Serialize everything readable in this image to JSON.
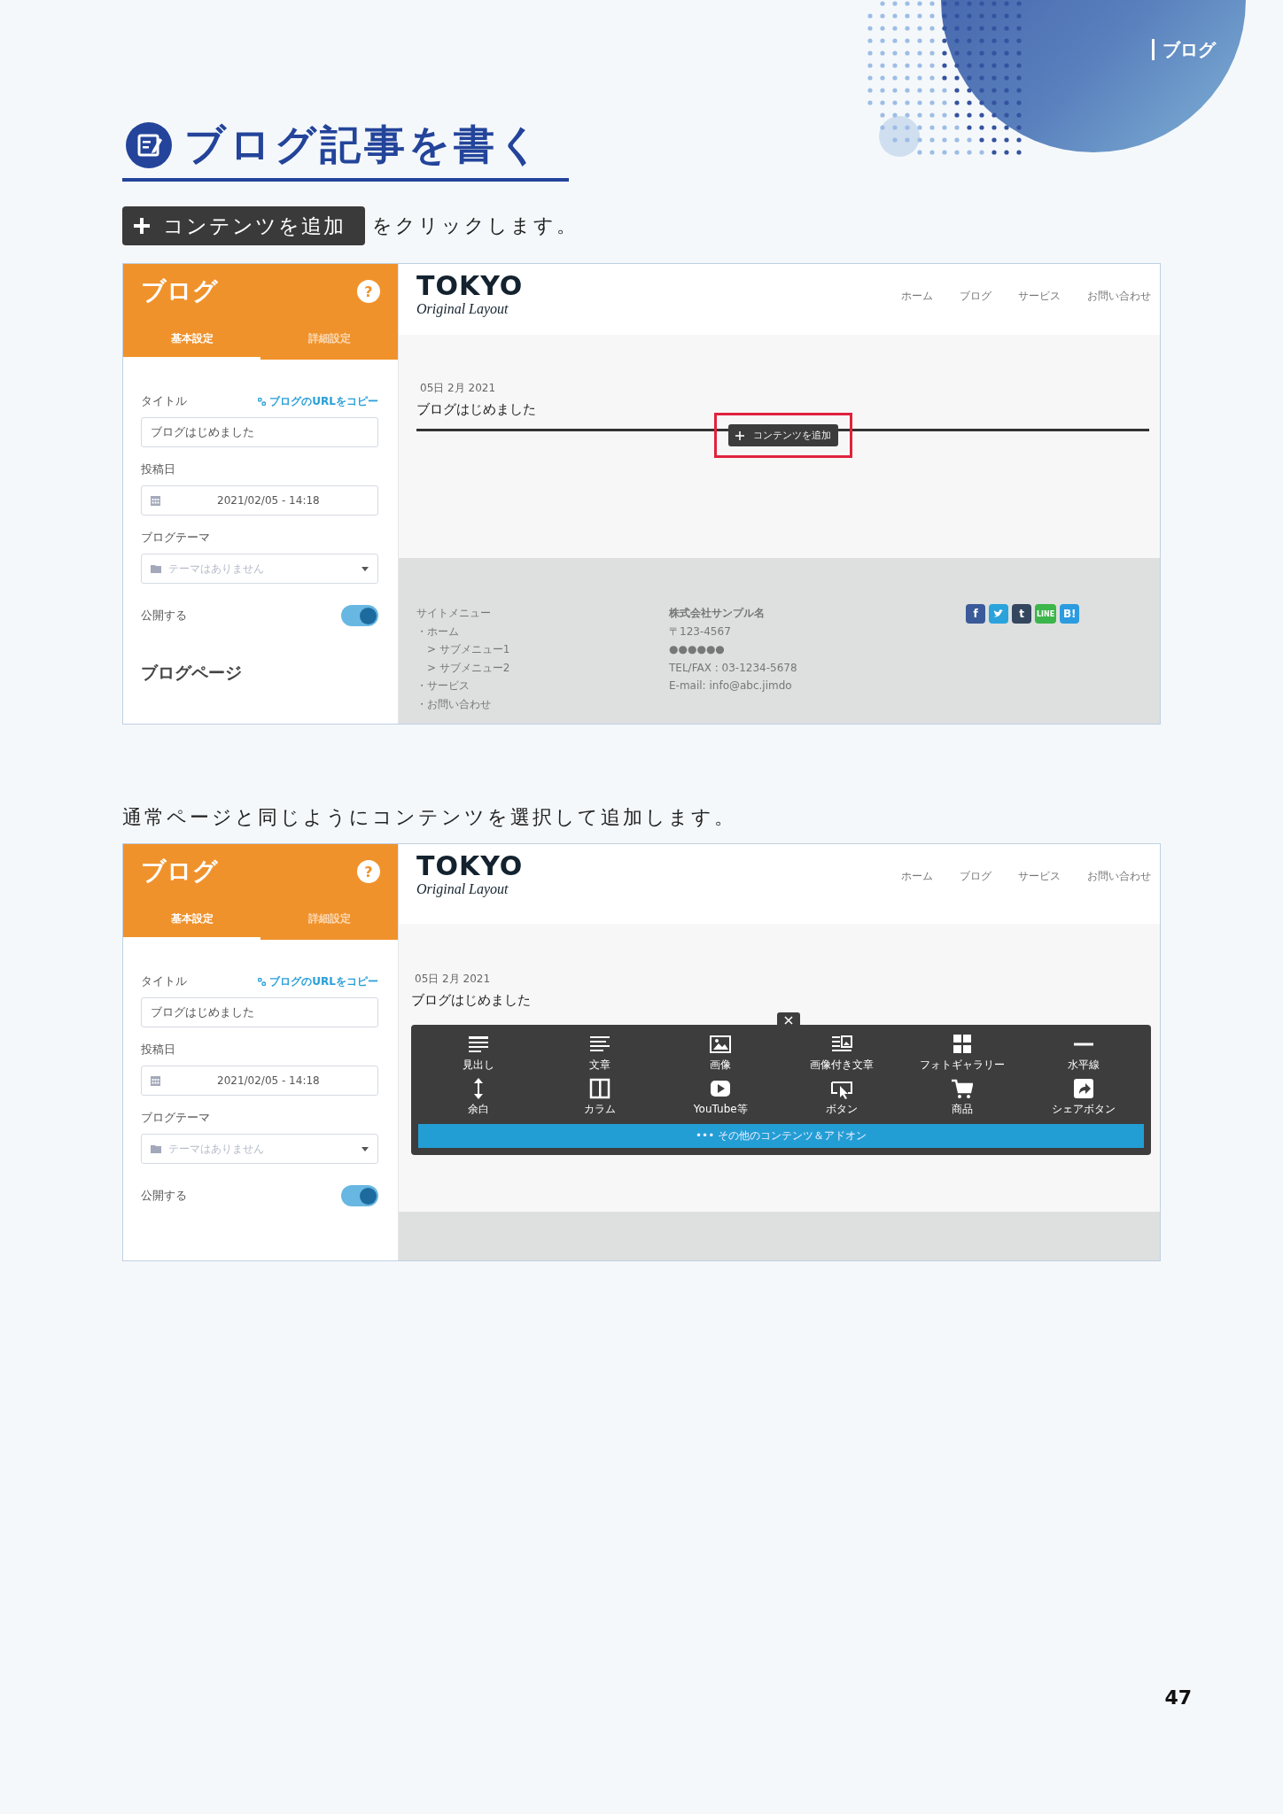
{
  "header_label": "ブログ",
  "heading": "ブログ記事を書く",
  "instruction_1": {
    "button_label": "コンテンツを追加",
    "text": "をクリックします。"
  },
  "screenshot_1": {
    "editor_panel": {
      "title": "ブログ",
      "help_button": "?",
      "tabs": [
        {
          "label": "基本設定",
          "selected": true
        },
        {
          "label": "詳細設定",
          "selected": false
        }
      ],
      "title_label": "タイトル",
      "copy_link": "ブログのURLをコピー",
      "title_value": "ブログはじめました",
      "date_label": "投稿日",
      "date_value": "2021/02/05 - 14:18",
      "theme_label": "ブログテーマ",
      "theme_placeholder": "テーマはありません",
      "publish": {
        "label": "公開する",
        "on": true
      },
      "section_heading": "ブログページ"
    },
    "site": {
      "logo_main": "TOKYO",
      "logo_sub": "Original Layout",
      "nav": [
        "ホーム",
        "ブログ",
        "サービス",
        "お問い合わせ"
      ],
      "post_date": "05日 2月 2021",
      "post_title": "ブログはじめました",
      "add_button": {
        "label": "コンテンツを追加",
        "highlighted": true
      },
      "footer": {
        "menu_title": "サイトメニュー",
        "menu_items": [
          {
            "label": "・ホーム",
            "children": [
              {
                "label": "> サブメニュー1"
              },
              {
                "label": "> サブメニュー2"
              }
            ]
          },
          {
            "label": "・サービス"
          },
          {
            "label": "・お問い合わせ"
          }
        ],
        "company": "株式会社サンプル名",
        "contact_lines": [
          "〒123-4567",
          "●●●●●●",
          "TEL/FAX : 03-1234-5678",
          "E-mail: info@abc.jimdo"
        ],
        "social": [
          {
            "label": "f",
            "color": "#3b5a9a"
          },
          {
            "color": "#2aa3dc"
          },
          {
            "label": "t",
            "color": "#34475e"
          },
          {
            "label": "LINE",
            "color": "#3cb54a"
          },
          {
            "label": "B!",
            "color": "#2c9be0"
          }
        ]
      }
    }
  },
  "instruction_2": "通常ページと同じようにコンテンツを選択して追加します。",
  "screenshot_2": {
    "editor_panel": {
      "title": "ブログ",
      "help_button": "?",
      "tabs": [
        {
          "label": "基本設定",
          "selected": true
        },
        {
          "label": "詳細設定",
          "selected": false
        }
      ],
      "title_label": "タイトル",
      "copy_link": "ブログのURLをコピー",
      "title_value": "ブログはじめました",
      "date_label": "投稿日",
      "date_value": "2021/02/05 - 14:18",
      "theme_label": "ブログテーマ",
      "theme_placeholder": "テーマはありません",
      "publish": {
        "label": "公開する",
        "on": true
      }
    },
    "site": {
      "logo_main": "TOKYO",
      "logo_sub": "Original Layout",
      "nav": [
        "ホーム",
        "ブログ",
        "サービス",
        "お問い合わせ"
      ],
      "post_date": "05日 2月 2021",
      "post_title": "ブログはじめました",
      "content_menu": {
        "items": [
          "見出し",
          "文章",
          "画像",
          "画像付き文章",
          "フォトギャラリー",
          "水平線",
          "余白",
          "カラム",
          "YouTube等",
          "ボタン",
          "商品",
          "シェアボタン"
        ],
        "more_label": "••• その他のコンテンツ＆アドオン"
      }
    }
  },
  "page_number": "47"
}
